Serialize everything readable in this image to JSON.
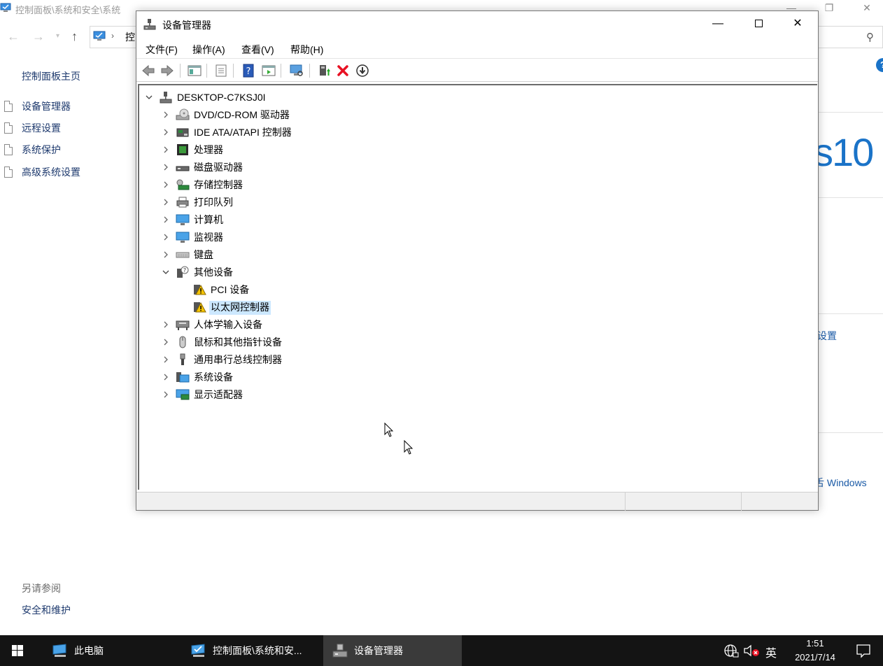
{
  "background_window": {
    "title": "控制面板\\系统和安全\\系统",
    "address_text": "控",
    "sidebar": {
      "home_link": "控制面板主页",
      "items": [
        {
          "label": "设备管理器"
        },
        {
          "label": "远程设置"
        },
        {
          "label": "系统保护"
        },
        {
          "label": "高级系统设置"
        }
      ],
      "see_also_heading": "另请参阅",
      "security_link": "安全和维护"
    },
    "right_partial": {
      "windows_logo_text": "s10",
      "settings_link": "设置",
      "activate_link": "舌 Windows"
    },
    "help_icon_glyph": "?"
  },
  "device_manager": {
    "title": "设备管理器",
    "menu": [
      {
        "label": "文件(F)"
      },
      {
        "label": "操作(A)"
      },
      {
        "label": "查看(V)"
      },
      {
        "label": "帮助(H)"
      }
    ],
    "toolbar_icons": [
      "back-arrow-icon",
      "forward-arrow-icon",
      "show-hide-console-tree-icon",
      "properties-icon",
      "help-icon",
      "action-pane-icon",
      "scan-hardware-icon",
      "update-driver-icon",
      "uninstall-icon",
      "disable-device-icon"
    ],
    "tree": {
      "root": {
        "label": "DESKTOP-C7KSJ0I",
        "expanded": true
      },
      "categories": [
        {
          "label": "DVD/CD-ROM 驱动器",
          "icon": "dvd-drive-icon",
          "expanded": false
        },
        {
          "label": "IDE ATA/ATAPI 控制器",
          "icon": "ide-controller-icon",
          "expanded": false
        },
        {
          "label": "处理器",
          "icon": "processor-icon",
          "expanded": false
        },
        {
          "label": "磁盘驱动器",
          "icon": "disk-drive-icon",
          "expanded": false
        },
        {
          "label": "存储控制器",
          "icon": "storage-controller-icon",
          "expanded": false
        },
        {
          "label": "打印队列",
          "icon": "print-queue-icon",
          "expanded": false
        },
        {
          "label": "计算机",
          "icon": "computer-icon",
          "expanded": false
        },
        {
          "label": "监视器",
          "icon": "monitor-icon",
          "expanded": false
        },
        {
          "label": "键盘",
          "icon": "keyboard-icon",
          "expanded": false
        },
        {
          "label": "其他设备",
          "icon": "other-devices-icon",
          "expanded": true,
          "children": [
            {
              "label": "PCI 设备",
              "icon": "warning-device-icon",
              "selected": false
            },
            {
              "label": "以太网控制器",
              "icon": "warning-device-icon",
              "selected": true
            }
          ]
        },
        {
          "label": "人体学输入设备",
          "icon": "hid-icon",
          "expanded": false
        },
        {
          "label": "鼠标和其他指针设备",
          "icon": "mouse-icon",
          "expanded": false
        },
        {
          "label": "通用串行总线控制器",
          "icon": "usb-icon",
          "expanded": false
        },
        {
          "label": "系统设备",
          "icon": "system-devices-icon",
          "expanded": false
        },
        {
          "label": "显示适配器",
          "icon": "display-adapter-icon",
          "expanded": false
        }
      ]
    }
  },
  "taskbar": {
    "items": [
      {
        "label": "此电脑",
        "icon": "this-pc-icon",
        "active": false
      },
      {
        "label": "控制面板\\系统和安...",
        "icon": "control-panel-icon",
        "active": false
      },
      {
        "label": "设备管理器",
        "icon": "device-manager-icon",
        "active": true
      }
    ],
    "tray": {
      "ime": "英",
      "time": "1:51",
      "date": "2021/7/14"
    }
  },
  "colors": {
    "accent": "#1a73c8",
    "selection": "#cce8ff",
    "taskbar": "#141414",
    "link": "#1e3a6e",
    "error_red": "#e81123"
  }
}
